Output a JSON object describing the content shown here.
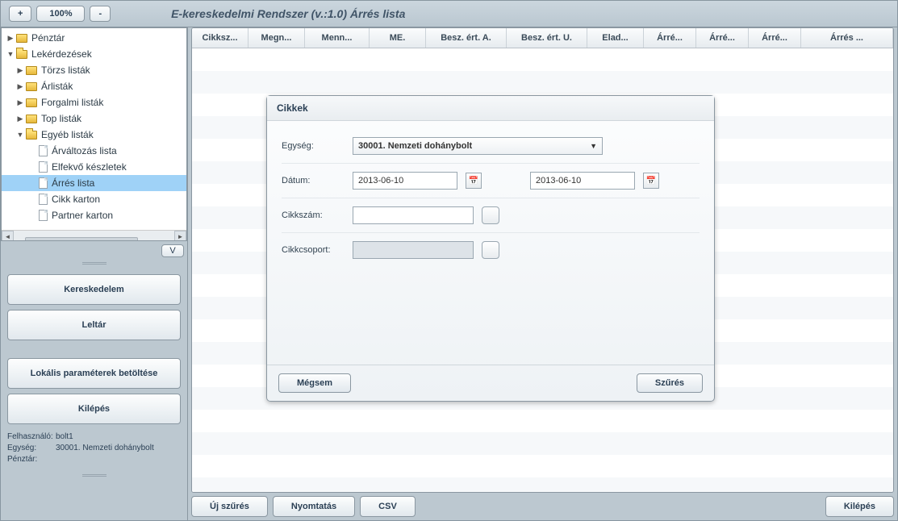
{
  "zoom": {
    "plus": "+",
    "level": "100%",
    "minus": "-"
  },
  "app_title": "E-kereskedelmi Rendszer (v.:1.0)   Árrés lista",
  "tree": {
    "penztar": "Pénztár",
    "lekerdezesek": "Lekérdezések",
    "torzs": "Törzs listák",
    "arlistak": "Árlisták",
    "forgalmi": "Forgalmi listák",
    "top": "Top listák",
    "egyeb": "Egyéb listák",
    "arvaltozas": "Árváltozás lista",
    "elfekvo": "Elfekvő készletek",
    "arres": "Árrés lista",
    "cikkkarton": "Cikk karton",
    "partner": "Partner karton"
  },
  "v_btn": "V",
  "side_buttons": {
    "kereskedelem": "Kereskedelem",
    "leltar": "Leltár",
    "lokalis": "Lokális paraméterek betöltése",
    "kilepes": "Kilépés"
  },
  "info": {
    "user_lbl": "Felhasználó:",
    "user": "bolt1",
    "unit_lbl": "Egység:",
    "unit": "30001. Nemzeti dohánybolt",
    "reg_lbl": "Pénztár:"
  },
  "grid_cols": [
    "Cikksz...",
    "Megn...",
    "Menn...",
    "ME.",
    "Besz. ért. A.",
    "Besz. ért. U.",
    "Elad...",
    "Árré...",
    "Árré...",
    "Árré...",
    "Árrés ..."
  ],
  "dialog": {
    "title": "Cikkek",
    "egyseg_lbl": "Egység:",
    "egyseg_value": "30001. Nemzeti dohánybolt",
    "datum_lbl": "Dátum:",
    "date_from": "2013-06-10",
    "date_to": "2013-06-10",
    "cikkszam_lbl": "Cikkszám:",
    "cikkcsoport_lbl": "Cikkcsoport:",
    "megsem": "Mégsem",
    "szures": "Szűrés"
  },
  "bottom": {
    "uj": "Új szűrés",
    "nyomtatas": "Nyomtatás",
    "csv": "CSV",
    "kilepes": "Kilépés"
  }
}
